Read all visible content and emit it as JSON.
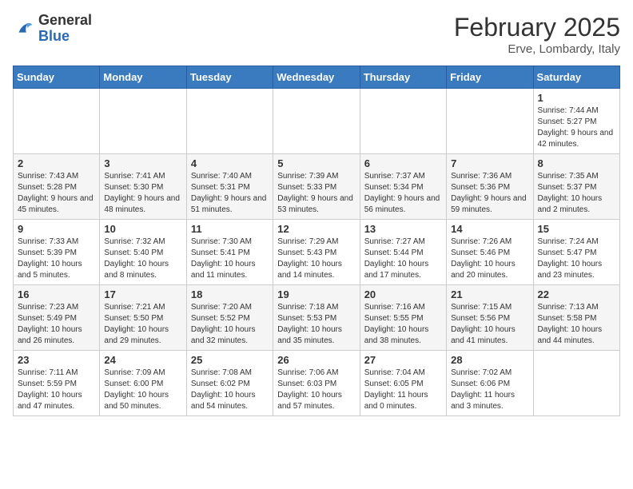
{
  "header": {
    "logo_general": "General",
    "logo_blue": "Blue",
    "month_title": "February 2025",
    "location": "Erve, Lombardy, Italy"
  },
  "weekdays": [
    "Sunday",
    "Monday",
    "Tuesday",
    "Wednesday",
    "Thursday",
    "Friday",
    "Saturday"
  ],
  "weeks": [
    [
      {
        "day": "",
        "info": ""
      },
      {
        "day": "",
        "info": ""
      },
      {
        "day": "",
        "info": ""
      },
      {
        "day": "",
        "info": ""
      },
      {
        "day": "",
        "info": ""
      },
      {
        "day": "",
        "info": ""
      },
      {
        "day": "1",
        "info": "Sunrise: 7:44 AM\nSunset: 5:27 PM\nDaylight: 9 hours and 42 minutes."
      }
    ],
    [
      {
        "day": "2",
        "info": "Sunrise: 7:43 AM\nSunset: 5:28 PM\nDaylight: 9 hours and 45 minutes."
      },
      {
        "day": "3",
        "info": "Sunrise: 7:41 AM\nSunset: 5:30 PM\nDaylight: 9 hours and 48 minutes."
      },
      {
        "day": "4",
        "info": "Sunrise: 7:40 AM\nSunset: 5:31 PM\nDaylight: 9 hours and 51 minutes."
      },
      {
        "day": "5",
        "info": "Sunrise: 7:39 AM\nSunset: 5:33 PM\nDaylight: 9 hours and 53 minutes."
      },
      {
        "day": "6",
        "info": "Sunrise: 7:37 AM\nSunset: 5:34 PM\nDaylight: 9 hours and 56 minutes."
      },
      {
        "day": "7",
        "info": "Sunrise: 7:36 AM\nSunset: 5:36 PM\nDaylight: 9 hours and 59 minutes."
      },
      {
        "day": "8",
        "info": "Sunrise: 7:35 AM\nSunset: 5:37 PM\nDaylight: 10 hours and 2 minutes."
      }
    ],
    [
      {
        "day": "9",
        "info": "Sunrise: 7:33 AM\nSunset: 5:39 PM\nDaylight: 10 hours and 5 minutes."
      },
      {
        "day": "10",
        "info": "Sunrise: 7:32 AM\nSunset: 5:40 PM\nDaylight: 10 hours and 8 minutes."
      },
      {
        "day": "11",
        "info": "Sunrise: 7:30 AM\nSunset: 5:41 PM\nDaylight: 10 hours and 11 minutes."
      },
      {
        "day": "12",
        "info": "Sunrise: 7:29 AM\nSunset: 5:43 PM\nDaylight: 10 hours and 14 minutes."
      },
      {
        "day": "13",
        "info": "Sunrise: 7:27 AM\nSunset: 5:44 PM\nDaylight: 10 hours and 17 minutes."
      },
      {
        "day": "14",
        "info": "Sunrise: 7:26 AM\nSunset: 5:46 PM\nDaylight: 10 hours and 20 minutes."
      },
      {
        "day": "15",
        "info": "Sunrise: 7:24 AM\nSunset: 5:47 PM\nDaylight: 10 hours and 23 minutes."
      }
    ],
    [
      {
        "day": "16",
        "info": "Sunrise: 7:23 AM\nSunset: 5:49 PM\nDaylight: 10 hours and 26 minutes."
      },
      {
        "day": "17",
        "info": "Sunrise: 7:21 AM\nSunset: 5:50 PM\nDaylight: 10 hours and 29 minutes."
      },
      {
        "day": "18",
        "info": "Sunrise: 7:20 AM\nSunset: 5:52 PM\nDaylight: 10 hours and 32 minutes."
      },
      {
        "day": "19",
        "info": "Sunrise: 7:18 AM\nSunset: 5:53 PM\nDaylight: 10 hours and 35 minutes."
      },
      {
        "day": "20",
        "info": "Sunrise: 7:16 AM\nSunset: 5:55 PM\nDaylight: 10 hours and 38 minutes."
      },
      {
        "day": "21",
        "info": "Sunrise: 7:15 AM\nSunset: 5:56 PM\nDaylight: 10 hours and 41 minutes."
      },
      {
        "day": "22",
        "info": "Sunrise: 7:13 AM\nSunset: 5:58 PM\nDaylight: 10 hours and 44 minutes."
      }
    ],
    [
      {
        "day": "23",
        "info": "Sunrise: 7:11 AM\nSunset: 5:59 PM\nDaylight: 10 hours and 47 minutes."
      },
      {
        "day": "24",
        "info": "Sunrise: 7:09 AM\nSunset: 6:00 PM\nDaylight: 10 hours and 50 minutes."
      },
      {
        "day": "25",
        "info": "Sunrise: 7:08 AM\nSunset: 6:02 PM\nDaylight: 10 hours and 54 minutes."
      },
      {
        "day": "26",
        "info": "Sunrise: 7:06 AM\nSunset: 6:03 PM\nDaylight: 10 hours and 57 minutes."
      },
      {
        "day": "27",
        "info": "Sunrise: 7:04 AM\nSunset: 6:05 PM\nDaylight: 11 hours and 0 minutes."
      },
      {
        "day": "28",
        "info": "Sunrise: 7:02 AM\nSunset: 6:06 PM\nDaylight: 11 hours and 3 minutes."
      },
      {
        "day": "",
        "info": ""
      }
    ]
  ]
}
